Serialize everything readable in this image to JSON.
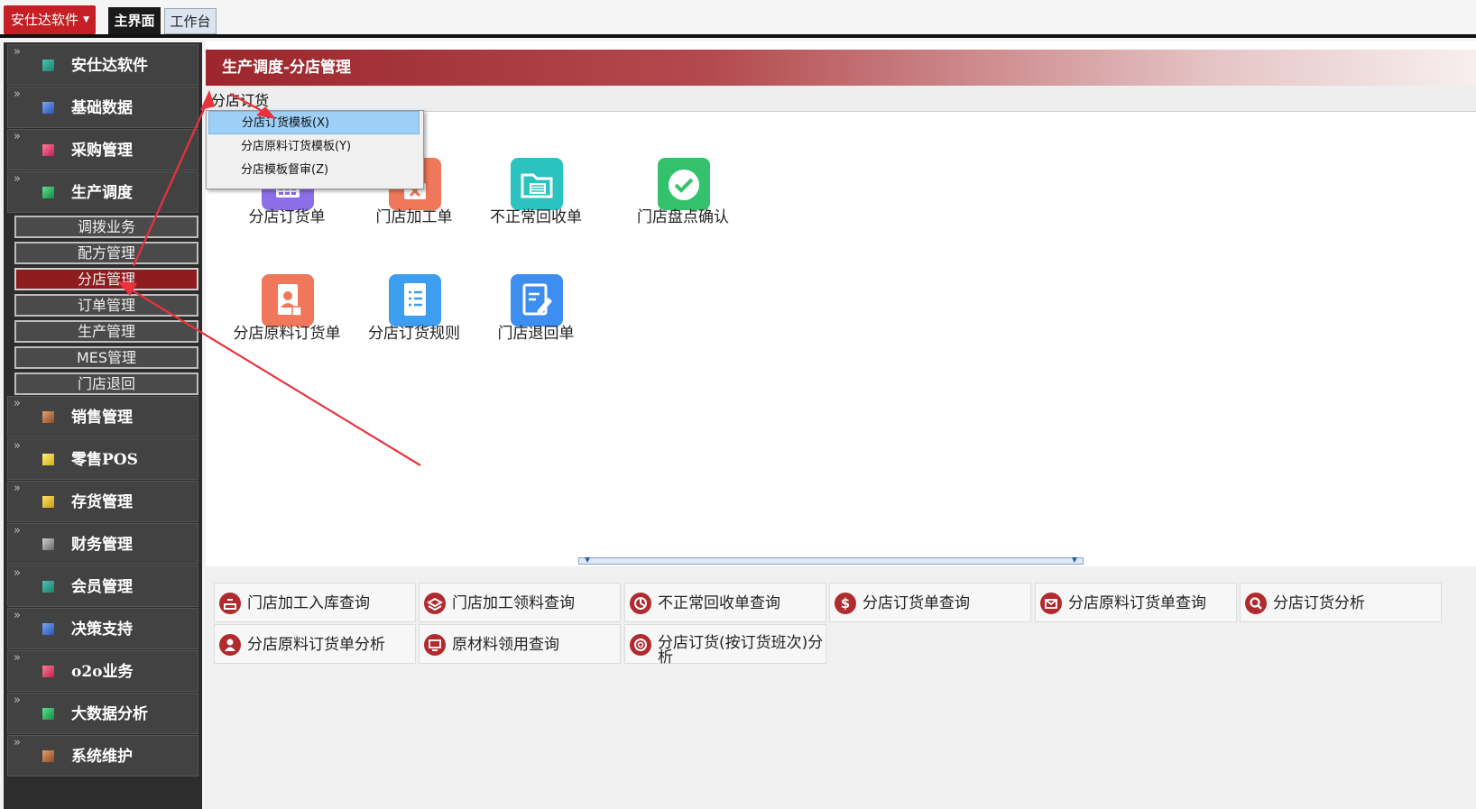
{
  "topbar": {
    "app_menu": "安仕达软件",
    "tabs": [
      "主界面",
      "工作台"
    ]
  },
  "sidebar": {
    "chevron": "»",
    "items": [
      {
        "label": "安仕达软件",
        "icon": "teal-square-icon",
        "color": "#2ca38e"
      },
      {
        "label": "基础数据",
        "icon": "blue-square-icon",
        "color": "#3a6fd8"
      },
      {
        "label": "采购管理",
        "icon": "pink-square-icon",
        "color": "#e0336a"
      },
      {
        "label": "生产调度",
        "icon": "green-square-icon",
        "color": "#1fb15a"
      },
      {
        "label": "销售管理",
        "icon": "brown-square-icon",
        "color": "#b06a3a"
      },
      {
        "label": "零售POS",
        "icon": "yellow-square-icon",
        "color": "#e6c619"
      },
      {
        "label": "存货管理",
        "icon": "yellow-square-icon",
        "color": "#e6bb19"
      },
      {
        "label": "财务管理",
        "icon": "gray-square-icon",
        "color": "#8a8a8a"
      },
      {
        "label": "会员管理",
        "icon": "teal-square-icon",
        "color": "#2ca38e"
      },
      {
        "label": "决策支持",
        "icon": "blue-square-icon",
        "color": "#3a6fd8"
      },
      {
        "label": "o2o业务",
        "icon": "pink-square-icon",
        "color": "#e0336a"
      },
      {
        "label": "大数据分析",
        "icon": "green-square-icon",
        "color": "#1fb15a"
      },
      {
        "label": "系统维护",
        "icon": "brown-square-icon",
        "color": "#b06a3a"
      }
    ],
    "subitems": [
      "调拨业务",
      "配方管理",
      "分店管理",
      "订单管理",
      "生产管理",
      "MES管理",
      "门店退回"
    ],
    "active_sub": "分店管理"
  },
  "content": {
    "title": "生产调度-分店管理",
    "menu": "分店订货",
    "dropdown": [
      "分店订货模板(X)",
      "分店原料订货模板(Y)",
      "分店模板督审(Z)"
    ],
    "icons": [
      {
        "label": "分店订货单",
        "icon": "calendar-grid-icon",
        "color": "#8c6ee6"
      },
      {
        "label": "门店加工单",
        "icon": "close-doc-icon",
        "color": "#f0775a"
      },
      {
        "label": "不正常回收单",
        "icon": "folder-list-icon",
        "color": "#2bc3bf"
      },
      {
        "label": "门店盘点确认",
        "icon": "check-circle-icon",
        "color": "#33c16b"
      },
      {
        "label": "分店原料订货单",
        "icon": "person-doc-icon",
        "color": "#f0775a"
      },
      {
        "label": "分店订货规则",
        "icon": "list-doc-icon",
        "color": "#3d9ef0"
      },
      {
        "label": "门店退回单",
        "icon": "edit-doc-icon",
        "color": "#3d8ef0"
      }
    ],
    "reports": [
      {
        "label": "门店加工入库查询",
        "icon": "inbox-icon"
      },
      {
        "label": "门店加工领料查询",
        "icon": "layers-icon"
      },
      {
        "label": "不正常回收单查询",
        "icon": "pie-chart-icon"
      },
      {
        "label": "分店订货单查询",
        "icon": "dollar-icon"
      },
      {
        "label": "分店原料订货单查询",
        "icon": "mail-icon"
      },
      {
        "label": "分店订货分析",
        "icon": "search-icon"
      },
      {
        "label": "分店原料订货单分析",
        "icon": "user-icon"
      },
      {
        "label": "原材料领用查询",
        "icon": "monitor-icon"
      },
      {
        "label": "分店订货(按订货班次)分析",
        "icon": "lifebuoy-icon"
      }
    ]
  }
}
